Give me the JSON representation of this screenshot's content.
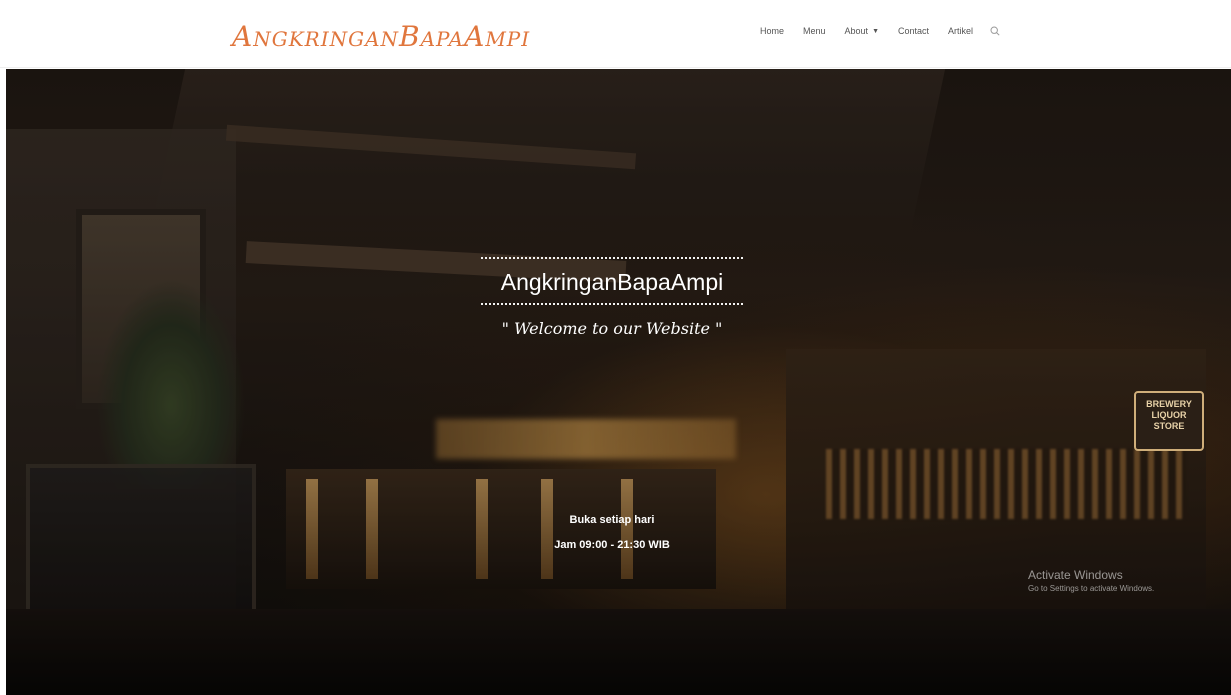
{
  "header": {
    "logo_text": "AngkringanBapaAmpi",
    "nav": [
      {
        "label": "Home"
      },
      {
        "label": "Menu"
      },
      {
        "label": "About",
        "has_dropdown": true
      },
      {
        "label": "Contact"
      },
      {
        "label": "Artikel"
      }
    ],
    "search_icon": "search-icon"
  },
  "hero": {
    "title": "AngkringanBapaAmpi",
    "tagline": "\" Welcome to our Website \"",
    "hours_line1": "Buka setiap hari",
    "hours_line2": "Jam 09:00 - 21:30 WIB",
    "sign_text": "BREWERY LIQUOR STORE"
  },
  "watermark": {
    "title": "Activate Windows",
    "subtitle": "Go to Settings to activate Windows."
  },
  "colors": {
    "logo": "#e0763d",
    "nav_text": "#555555",
    "hero_text": "#ffffff"
  }
}
